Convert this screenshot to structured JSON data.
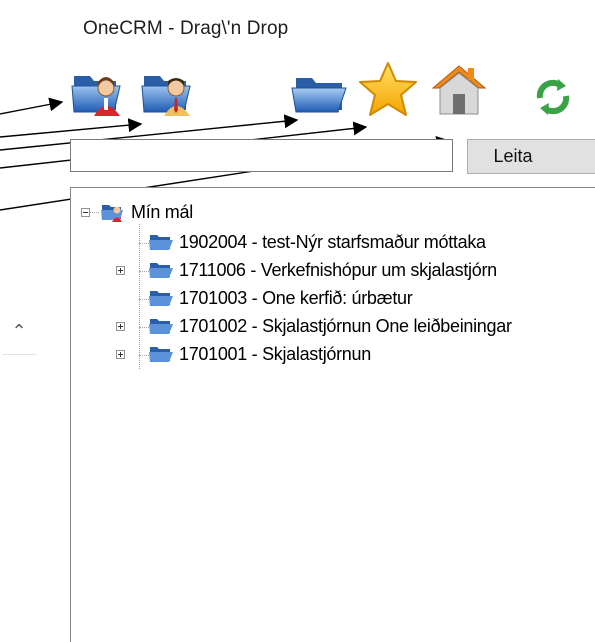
{
  "window": {
    "title": "OneCRM - Drag\\'n Drop"
  },
  "toolbar": {
    "icons": [
      {
        "name": "folder-user-female-icon"
      },
      {
        "name": "folder-user-male-icon"
      },
      {
        "name": "folder-icon"
      },
      {
        "name": "star-icon"
      },
      {
        "name": "home-icon"
      },
      {
        "name": "refresh-icon"
      }
    ]
  },
  "search": {
    "value": "",
    "placeholder": "",
    "button_label": "Leita"
  },
  "tree": {
    "root": {
      "label": "Mín mál",
      "expanded": true
    },
    "items": [
      {
        "label": "1902004 - test-Nýr starfsmaður móttaka",
        "expandable": false
      },
      {
        "label": "1711006 - Verkefnishópur um skjalastjórn",
        "expandable": true
      },
      {
        "label": "1701003 - One kerfið: úrbætur",
        "expandable": false
      },
      {
        "label": "1701002 - Skjalastjórnun One leiðbeiningar",
        "expandable": true
      },
      {
        "label": "1701001 - Skjalastjórnun",
        "expandable": true
      }
    ]
  },
  "colors": {
    "folder_blue": "#2f6fc4",
    "star_yellow": "#ffcc1a",
    "refresh_green": "#3aa345",
    "button_bg": "#e1e1e1"
  }
}
